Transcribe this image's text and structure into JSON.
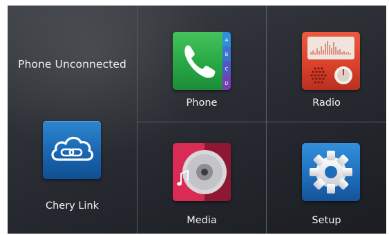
{
  "status": {
    "phone_text": "Phone Unconnected"
  },
  "apps": {
    "chery_link": {
      "label": "Chery Link",
      "icon": "cloud-link-icon"
    },
    "phone": {
      "label": "Phone",
      "icon": "phone-handset-icon",
      "index_letters": [
        "A",
        "B",
        "C",
        "D"
      ]
    },
    "radio": {
      "label": "Radio",
      "icon": "radio-icon"
    },
    "media": {
      "label": "Media",
      "icon": "music-disc-icon"
    },
    "setup": {
      "label": "Setup",
      "icon": "gear-icon"
    }
  },
  "colors": {
    "phone_tile": "#27a844",
    "radio_tile": "#d8402a",
    "media_tile": "#c8234a",
    "setup_tile": "#1e6cb8",
    "chery_tile": "#1a66b2"
  }
}
